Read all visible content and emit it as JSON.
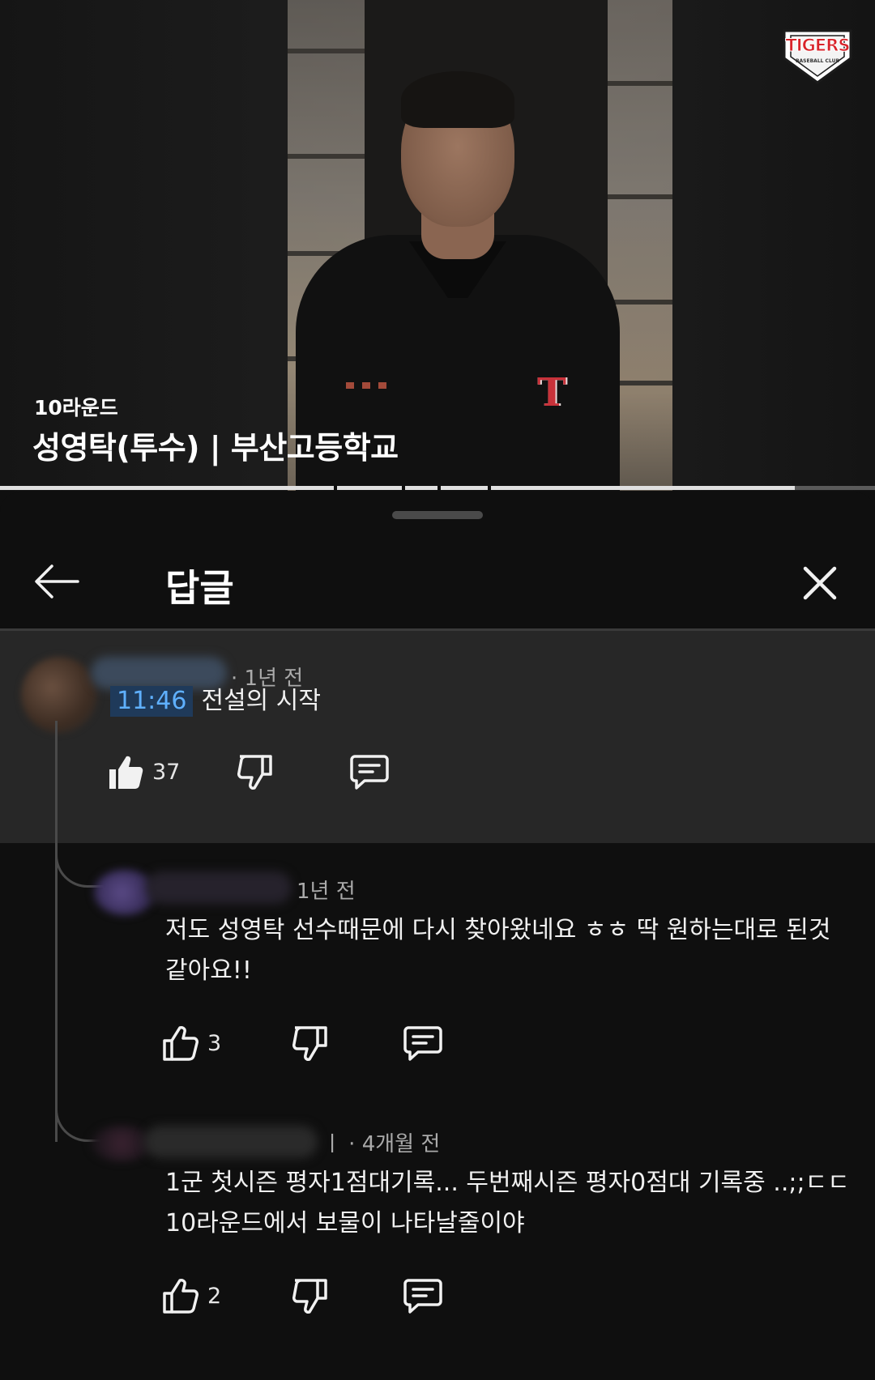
{
  "video": {
    "round": "10라운드",
    "title": "성영탁(투수) | 부산고등학교",
    "progress": 0.908,
    "logo_text": "TIGERS",
    "logo_subtext": "BASEBALL CLUB"
  },
  "panel": {
    "title": "답글",
    "back_icon": "arrow-left-icon",
    "close_icon": "close-icon"
  },
  "comments": [
    {
      "time": "· 1년 전",
      "timestamp": "11:46",
      "text": "전설의 시작",
      "likes": "37",
      "liked": true
    },
    {
      "time": "1년 전",
      "text_line1": "저도 성영탁 선수때문에 다시 찾아왔네요 ㅎㅎ 딱 원하는대로 된것",
      "text_line2": "같아요!!",
      "likes": "3",
      "liked": false
    },
    {
      "time": "ㅣ · 4개월 전",
      "text_line1": "1군 첫시즌 평자1점대기록... 두번째시즌 평자0점대 기록중 ..;;ㄷㄷ",
      "text_line2": "10라운드에서 보물이 나타날줄이야",
      "likes": "2",
      "liked": false
    }
  ]
}
